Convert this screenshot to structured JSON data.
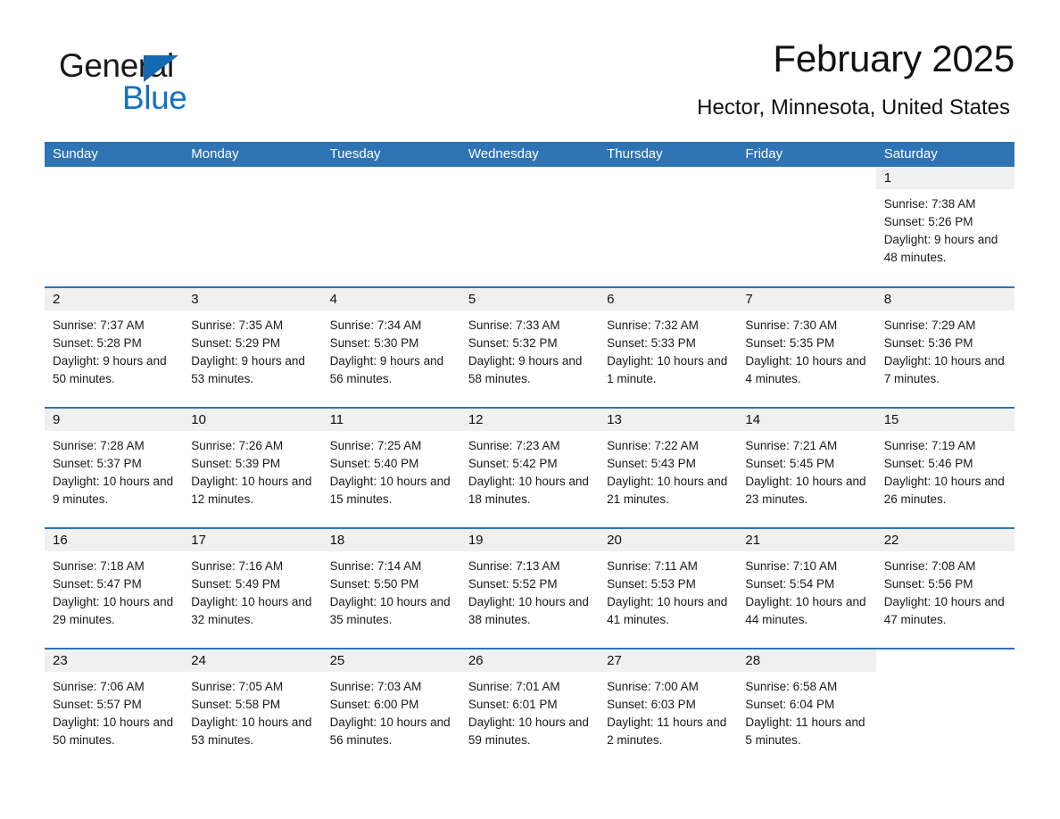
{
  "brand": {
    "name_part1": "General",
    "name_part2": "Blue",
    "accent_color": "#1272c4",
    "triangle_color": "#1569b0"
  },
  "header": {
    "month_title": "February 2025",
    "location": "Hector, Minnesota, United States"
  },
  "theme": {
    "header_blue": "#2e74b5",
    "daynum_band": "#f0f0f0"
  },
  "weekdays": [
    "Sunday",
    "Monday",
    "Tuesday",
    "Wednesday",
    "Thursday",
    "Friday",
    "Saturday"
  ],
  "weeks": [
    [
      {
        "day": "",
        "empty": true
      },
      {
        "day": "",
        "empty": true
      },
      {
        "day": "",
        "empty": true
      },
      {
        "day": "",
        "empty": true
      },
      {
        "day": "",
        "empty": true
      },
      {
        "day": "",
        "empty": true
      },
      {
        "day": "1",
        "sunrise": "Sunrise: 7:38 AM",
        "sunset": "Sunset: 5:26 PM",
        "daylight": "Daylight: 9 hours and 48 minutes."
      }
    ],
    [
      {
        "day": "2",
        "sunrise": "Sunrise: 7:37 AM",
        "sunset": "Sunset: 5:28 PM",
        "daylight": "Daylight: 9 hours and 50 minutes."
      },
      {
        "day": "3",
        "sunrise": "Sunrise: 7:35 AM",
        "sunset": "Sunset: 5:29 PM",
        "daylight": "Daylight: 9 hours and 53 minutes."
      },
      {
        "day": "4",
        "sunrise": "Sunrise: 7:34 AM",
        "sunset": "Sunset: 5:30 PM",
        "daylight": "Daylight: 9 hours and 56 minutes."
      },
      {
        "day": "5",
        "sunrise": "Sunrise: 7:33 AM",
        "sunset": "Sunset: 5:32 PM",
        "daylight": "Daylight: 9 hours and 58 minutes."
      },
      {
        "day": "6",
        "sunrise": "Sunrise: 7:32 AM",
        "sunset": "Sunset: 5:33 PM",
        "daylight": "Daylight: 10 hours and 1 minute."
      },
      {
        "day": "7",
        "sunrise": "Sunrise: 7:30 AM",
        "sunset": "Sunset: 5:35 PM",
        "daylight": "Daylight: 10 hours and 4 minutes."
      },
      {
        "day": "8",
        "sunrise": "Sunrise: 7:29 AM",
        "sunset": "Sunset: 5:36 PM",
        "daylight": "Daylight: 10 hours and 7 minutes."
      }
    ],
    [
      {
        "day": "9",
        "sunrise": "Sunrise: 7:28 AM",
        "sunset": "Sunset: 5:37 PM",
        "daylight": "Daylight: 10 hours and 9 minutes."
      },
      {
        "day": "10",
        "sunrise": "Sunrise: 7:26 AM",
        "sunset": "Sunset: 5:39 PM",
        "daylight": "Daylight: 10 hours and 12 minutes."
      },
      {
        "day": "11",
        "sunrise": "Sunrise: 7:25 AM",
        "sunset": "Sunset: 5:40 PM",
        "daylight": "Daylight: 10 hours and 15 minutes."
      },
      {
        "day": "12",
        "sunrise": "Sunrise: 7:23 AM",
        "sunset": "Sunset: 5:42 PM",
        "daylight": "Daylight: 10 hours and 18 minutes."
      },
      {
        "day": "13",
        "sunrise": "Sunrise: 7:22 AM",
        "sunset": "Sunset: 5:43 PM",
        "daylight": "Daylight: 10 hours and 21 minutes."
      },
      {
        "day": "14",
        "sunrise": "Sunrise: 7:21 AM",
        "sunset": "Sunset: 5:45 PM",
        "daylight": "Daylight: 10 hours and 23 minutes."
      },
      {
        "day": "15",
        "sunrise": "Sunrise: 7:19 AM",
        "sunset": "Sunset: 5:46 PM",
        "daylight": "Daylight: 10 hours and 26 minutes."
      }
    ],
    [
      {
        "day": "16",
        "sunrise": "Sunrise: 7:18 AM",
        "sunset": "Sunset: 5:47 PM",
        "daylight": "Daylight: 10 hours and 29 minutes."
      },
      {
        "day": "17",
        "sunrise": "Sunrise: 7:16 AM",
        "sunset": "Sunset: 5:49 PM",
        "daylight": "Daylight: 10 hours and 32 minutes."
      },
      {
        "day": "18",
        "sunrise": "Sunrise: 7:14 AM",
        "sunset": "Sunset: 5:50 PM",
        "daylight": "Daylight: 10 hours and 35 minutes."
      },
      {
        "day": "19",
        "sunrise": "Sunrise: 7:13 AM",
        "sunset": "Sunset: 5:52 PM",
        "daylight": "Daylight: 10 hours and 38 minutes."
      },
      {
        "day": "20",
        "sunrise": "Sunrise: 7:11 AM",
        "sunset": "Sunset: 5:53 PM",
        "daylight": "Daylight: 10 hours and 41 minutes."
      },
      {
        "day": "21",
        "sunrise": "Sunrise: 7:10 AM",
        "sunset": "Sunset: 5:54 PM",
        "daylight": "Daylight: 10 hours and 44 minutes."
      },
      {
        "day": "22",
        "sunrise": "Sunrise: 7:08 AM",
        "sunset": "Sunset: 5:56 PM",
        "daylight": "Daylight: 10 hours and 47 minutes."
      }
    ],
    [
      {
        "day": "23",
        "sunrise": "Sunrise: 7:06 AM",
        "sunset": "Sunset: 5:57 PM",
        "daylight": "Daylight: 10 hours and 50 minutes."
      },
      {
        "day": "24",
        "sunrise": "Sunrise: 7:05 AM",
        "sunset": "Sunset: 5:58 PM",
        "daylight": "Daylight: 10 hours and 53 minutes."
      },
      {
        "day": "25",
        "sunrise": "Sunrise: 7:03 AM",
        "sunset": "Sunset: 6:00 PM",
        "daylight": "Daylight: 10 hours and 56 minutes."
      },
      {
        "day": "26",
        "sunrise": "Sunrise: 7:01 AM",
        "sunset": "Sunset: 6:01 PM",
        "daylight": "Daylight: 10 hours and 59 minutes."
      },
      {
        "day": "27",
        "sunrise": "Sunrise: 7:00 AM",
        "sunset": "Sunset: 6:03 PM",
        "daylight": "Daylight: 11 hours and 2 minutes."
      },
      {
        "day": "28",
        "sunrise": "Sunrise: 6:58 AM",
        "sunset": "Sunset: 6:04 PM",
        "daylight": "Daylight: 11 hours and 5 minutes."
      },
      {
        "day": "",
        "empty": true
      }
    ]
  ]
}
